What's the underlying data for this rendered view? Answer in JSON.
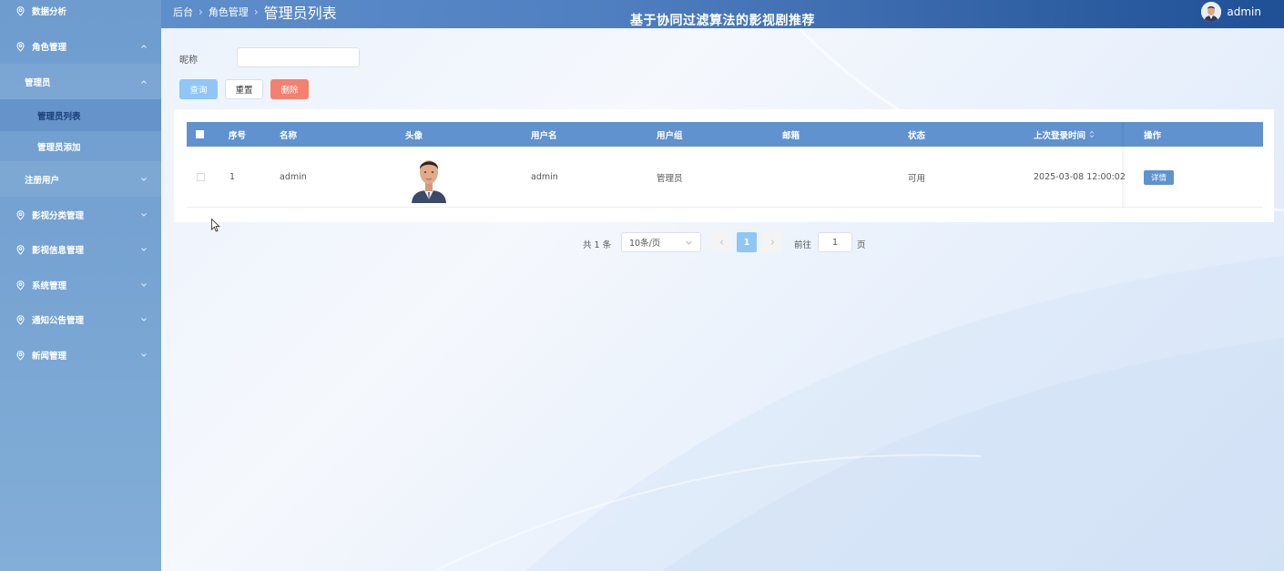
{
  "header": {
    "breadcrumbs": [
      "后台",
      "角色管理",
      "管理员列表"
    ],
    "site_title": "基于协同过滤算法的影视剧推荐",
    "username": "admin"
  },
  "sidebar": {
    "items": [
      {
        "label": "数据分析",
        "icon": "location-pin-icon"
      },
      {
        "label": "角色管理",
        "icon": "location-pin-icon",
        "expanded": true
      },
      {
        "label": "管理员",
        "expanded": true
      },
      {
        "label": "管理员列表",
        "active": true
      },
      {
        "label": "管理员添加"
      },
      {
        "label": "注册用户"
      },
      {
        "label": "影视分类管理",
        "icon": "location-pin-icon"
      },
      {
        "label": "影视信息管理",
        "icon": "location-pin-icon"
      },
      {
        "label": "系统管理",
        "icon": "location-pin-icon"
      },
      {
        "label": "通知公告管理",
        "icon": "location-pin-icon"
      },
      {
        "label": "新闻管理",
        "icon": "location-pin-icon"
      }
    ]
  },
  "search": {
    "label": "昵称",
    "value": "",
    "query_label": "查询",
    "reset_label": "重置",
    "delete_label": "删除"
  },
  "table": {
    "columns": [
      "序号",
      "名称",
      "头像",
      "用户名",
      "用户组",
      "邮箱",
      "状态",
      "上次登录时间",
      "操作"
    ],
    "rows": [
      {
        "index": "1",
        "name": "admin",
        "avatar": "portrait-photo",
        "username": "admin",
        "group": "管理员",
        "email": "",
        "status": "可用",
        "last_login": "2025-03-08 12:00:02",
        "action": "详情"
      }
    ]
  },
  "pagination": {
    "total": "共 1 条",
    "page_size": "10条/页",
    "current_page": "1",
    "goto_label": "前往",
    "goto_value": "1",
    "page_unit": "页"
  },
  "colors": {
    "sidebar": "#77a4d2",
    "table_header": "#5f92cf",
    "query_button": "#8fc6f6",
    "delete_button": "#f6806f"
  }
}
